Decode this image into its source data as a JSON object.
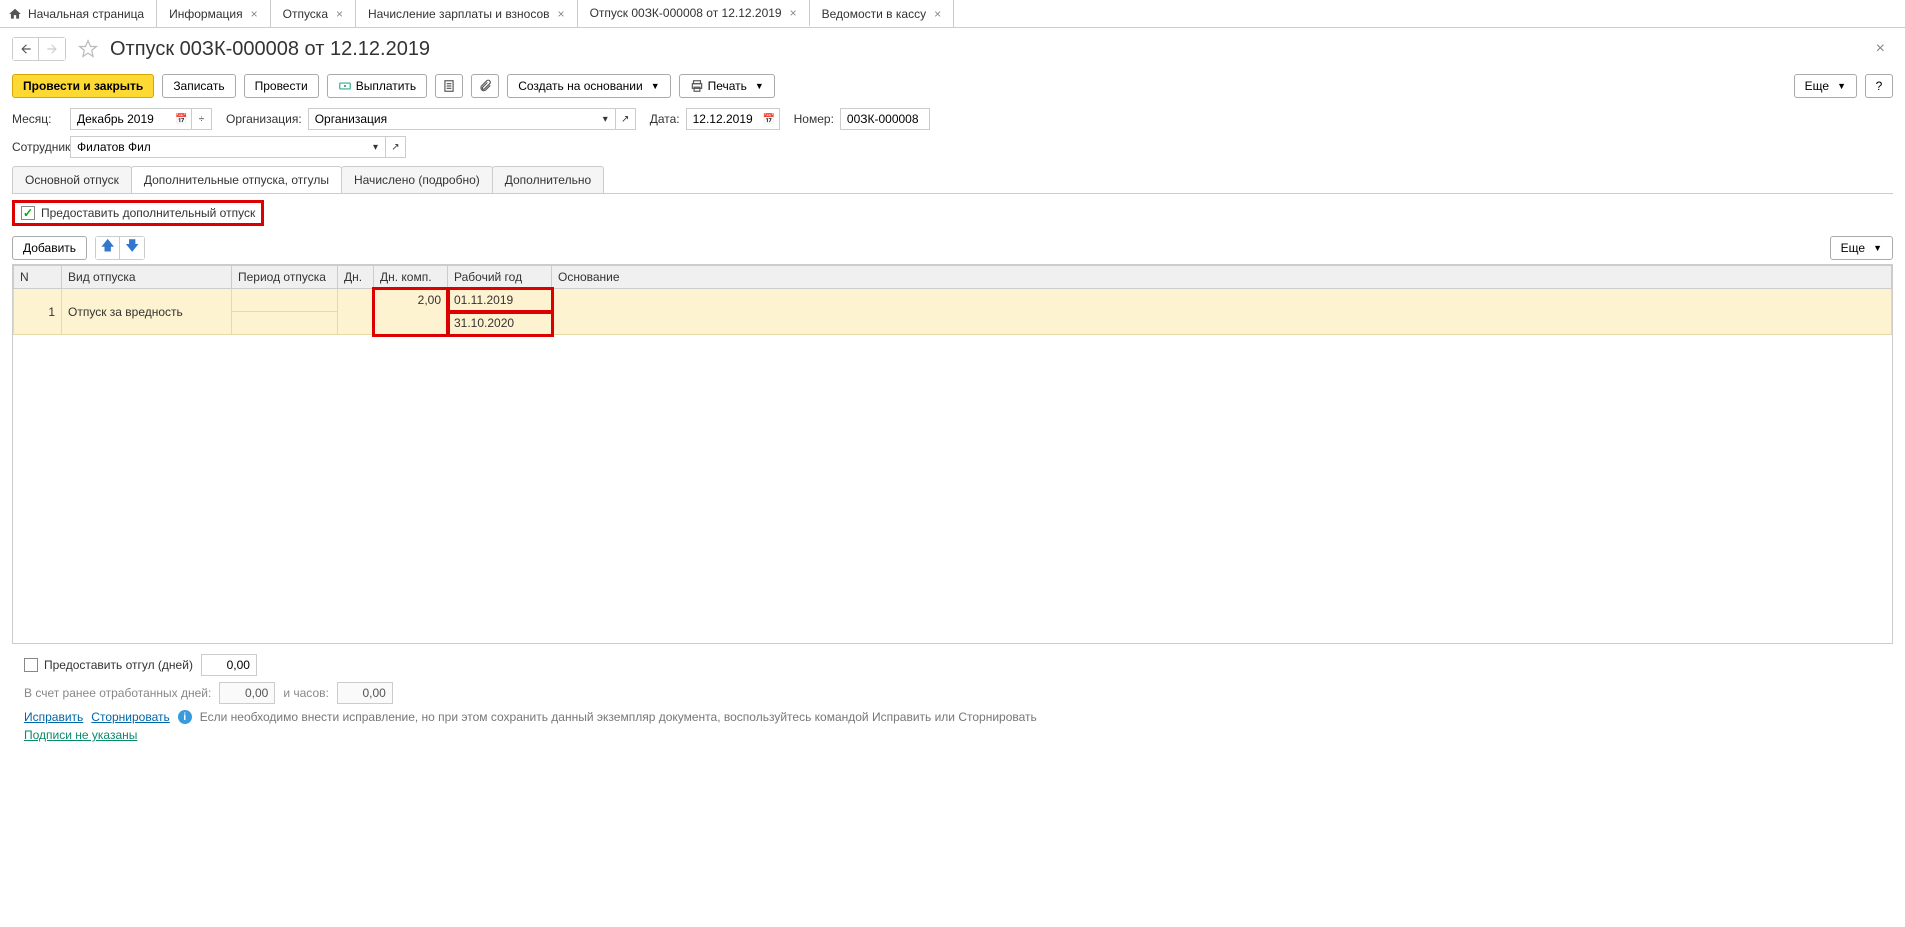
{
  "tabs": [
    {
      "label": "Начальная страница",
      "home": true,
      "closable": false
    },
    {
      "label": "Информация",
      "closable": true
    },
    {
      "label": "Отпуска",
      "closable": true
    },
    {
      "label": "Начисление зарплаты и взносов",
      "closable": true
    },
    {
      "label": "Отпуск 00ЗК-000008 от 12.12.2019",
      "closable": true,
      "active": true
    },
    {
      "label": "Ведомости в кассу",
      "closable": true
    }
  ],
  "page_title": "Отпуск 00ЗК-000008 от 12.12.2019",
  "toolbar": {
    "post_close": "Провести и закрыть",
    "save": "Записать",
    "post": "Провести",
    "pay": "Выплатить",
    "create_based": "Создать на основании",
    "print": "Печать",
    "more": "Еще"
  },
  "form": {
    "month_label": "Месяц:",
    "month_value": "Декабрь 2019",
    "org_label": "Организация:",
    "org_value": "Организация",
    "date_label": "Дата:",
    "date_value": "12.12.2019",
    "number_label": "Номер:",
    "number_value": "00ЗК-000008",
    "employee_label": "Сотрудник:",
    "employee_value": "Филатов Фил"
  },
  "panel_tabs": [
    "Основной отпуск",
    "Дополнительные отпуска, отгулы",
    "Начислено (подробно)",
    "Дополнительно"
  ],
  "checkbox_label": "Предоставить дополнительный отпуск",
  "table_toolbar": {
    "add": "Добавить",
    "more": "Еще"
  },
  "table": {
    "headers": {
      "n": "N",
      "type": "Вид отпуска",
      "period": "Период отпуска",
      "days": "Дн.",
      "comp_days": "Дн. комп.",
      "work_year": "Рабочий год",
      "basis": "Основание"
    },
    "rows": [
      {
        "n": "1",
        "type": "Отпуск за вредность",
        "period": "",
        "days": "",
        "comp_days": "2,00",
        "work_year_from": "01.11.2019",
        "work_year_to": "31.10.2020",
        "basis": ""
      }
    ]
  },
  "bottom": {
    "otgul_label": "Предоставить отгул (дней)",
    "otgul_value": "0,00",
    "worked_label": "В счет ранее отработанных дней:",
    "worked_days": "0,00",
    "hours_label": "и часов:",
    "worked_hours": "0,00",
    "fix_link": "Исправить",
    "storno_link": "Сторнировать",
    "info_text": "Если необходимо внести исправление, но при этом сохранить данный экземпляр документа, воспользуйтесь командой Исправить или Сторнировать",
    "sign_link": "Подписи не указаны"
  }
}
